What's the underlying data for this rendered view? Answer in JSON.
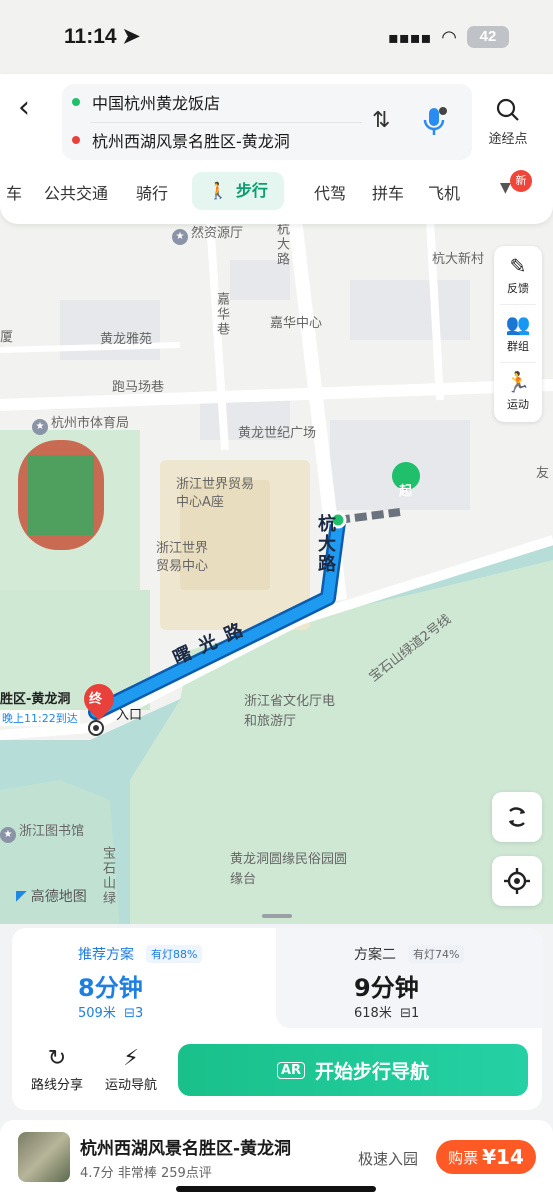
{
  "status": {
    "time": "11:14",
    "battery": "42"
  },
  "route": {
    "origin": "中国杭州黄龙饭店",
    "destination": "杭州西湖风景名胜区-黄龙洞",
    "waypoint_label": "途经点",
    "origin_color": "#1fbf6b",
    "destination_color": "#e8413c"
  },
  "modes": {
    "items": [
      "车",
      "公共交通",
      "骑行",
      "步行",
      "代驾",
      "拼车",
      "飞机"
    ],
    "active": "步行",
    "new_badge": "新"
  },
  "tools": {
    "feedback": "反馈",
    "group": "群组",
    "sport": "运动"
  },
  "map": {
    "labels": {
      "kaiyuan": "然资源厅",
      "hangda_road": "杭大路",
      "hangda_xincun": "杭大新村",
      "jiahua_lane": "嘉华巷",
      "huanglong_yayuan": "黄龙雅苑",
      "jiahua_center": "嘉华中心",
      "xia": "厦",
      "paomachang": "跑马场巷",
      "gym": "杭州市体育局",
      "huanglong_plaza": "黄龙世纪广场",
      "you": "友",
      "trade_a": "浙江世界贸易中心A座",
      "trade": "浙江世界贸易中心",
      "shuguang": "曙光路",
      "hangda_vertical": "杭大路",
      "dest_label": "胜区-黄龙洞",
      "arrival": "晚上11:22到达",
      "entrance": "入口",
      "culture_dept": "浙江省文化厅电和旅游厅",
      "baoshi_greenway": "宝石山绿道2号线",
      "library": "浙江图书馆",
      "baoshi_vertical": "宝石山绿",
      "huanglongdong_park": "黄龙洞圆缘民俗园圆缘台",
      "start_marker": "起",
      "end_marker": "终",
      "logo": "高德地图"
    }
  },
  "plans": [
    {
      "title": "推荐方案",
      "lights": "有灯88%",
      "time": "8分钟",
      "distance": "509米",
      "signals": "3"
    },
    {
      "title": "方案二",
      "lights": "有灯74%",
      "time": "9分钟",
      "distance": "618米",
      "signals": "1"
    }
  ],
  "actions": {
    "share": "路线分享",
    "sport_nav": "运动导航",
    "start": "开始步行导航"
  },
  "poi": {
    "name": "杭州西湖风景名胜区-黄龙洞",
    "rating": "4.7分",
    "comment": "非常棒",
    "reviews": "259点评",
    "fast_entry": "极速入园",
    "ticket_label": "购票",
    "price": "¥14"
  },
  "colors": {
    "accent": "#19c08a",
    "route": "#1e88e5",
    "ticket": "#ff5a26"
  }
}
